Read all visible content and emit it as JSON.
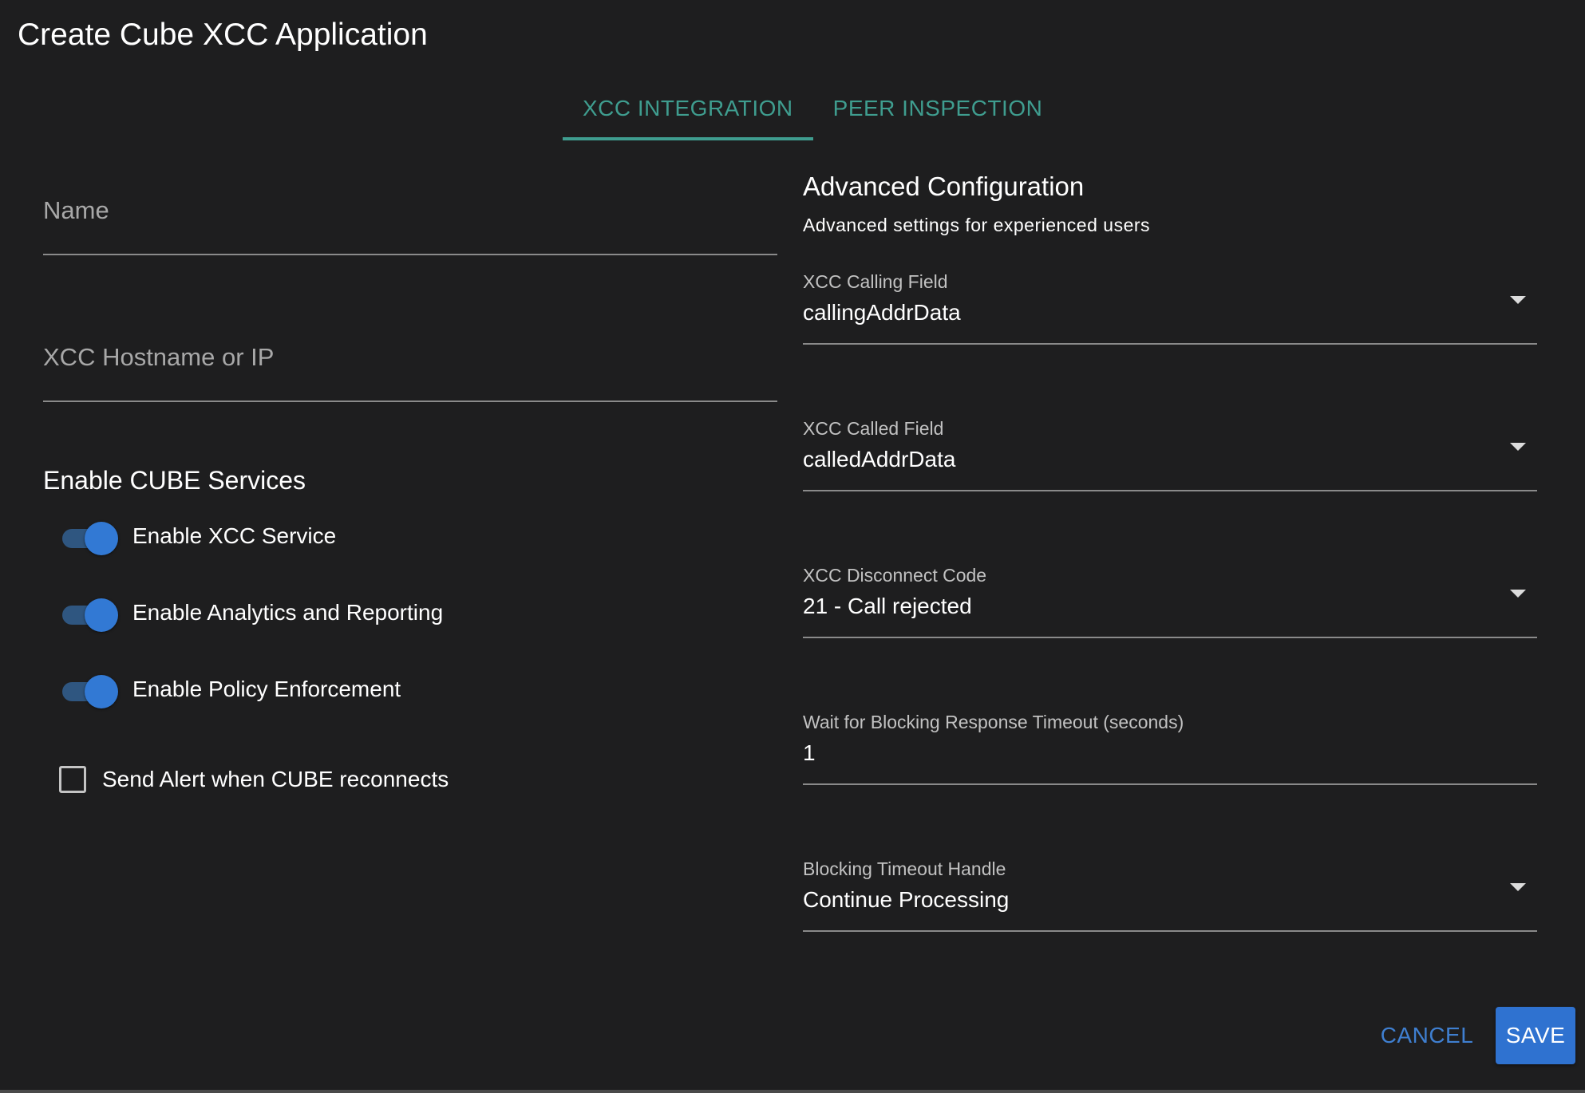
{
  "dialog": {
    "title": "Create Cube XCC Application"
  },
  "tabs": [
    {
      "label": "XCC INTEGRATION",
      "active": true
    },
    {
      "label": "PEER INSPECTION",
      "active": false
    }
  ],
  "left": {
    "name_field": {
      "placeholder": "Name",
      "value": ""
    },
    "host_field": {
      "placeholder": "XCC Hostname or IP",
      "value": ""
    },
    "services_title": "Enable CUBE Services",
    "toggles": [
      {
        "label": "Enable XCC Service",
        "checked": true
      },
      {
        "label": "Enable Analytics and Reporting",
        "checked": true
      },
      {
        "label": "Enable Policy Enforcement",
        "checked": true
      }
    ],
    "alert_checkbox": {
      "label": "Send Alert when CUBE reconnects",
      "checked": false
    }
  },
  "advanced": {
    "title": "Advanced Configuration",
    "subtitle": "Advanced settings for experienced users",
    "fields": [
      {
        "label": "XCC Calling Field",
        "value": "callingAddrData",
        "type": "select"
      },
      {
        "label": "XCC Called Field",
        "value": "calledAddrData",
        "type": "select"
      },
      {
        "label": "XCC Disconnect Code",
        "value": "21 - Call rejected",
        "type": "select"
      },
      {
        "label": "Wait for Blocking Response Timeout (seconds)",
        "value": "1",
        "type": "number"
      },
      {
        "label": "Blocking Timeout Handle",
        "value": "Continue Processing",
        "type": "select"
      }
    ]
  },
  "actions": {
    "cancel_label": "CANCEL",
    "save_label": "SAVE"
  },
  "colors": {
    "background": "#1e1e1f",
    "tab_accent": "#3f9d8f",
    "primary": "#2f72d0",
    "switch_thumb": "#3279d4"
  }
}
